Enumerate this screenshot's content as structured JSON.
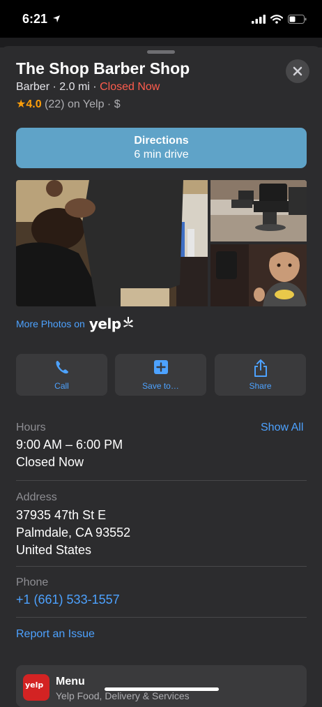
{
  "status_bar": {
    "time": "6:21"
  },
  "place": {
    "name": "The Shop Barber Shop",
    "category": "Barber",
    "separator": "·",
    "distance": "2.0 mi",
    "open_status": "Closed Now",
    "rating": "4.0",
    "review_count": "(22)",
    "rating_source": "on Yelp",
    "price": "$"
  },
  "directions": {
    "label": "Directions",
    "sublabel": "6 min drive"
  },
  "photos": {
    "more_label": "More Photos on",
    "provider": "yelp"
  },
  "actions": [
    {
      "label": "Call",
      "icon": "phone-icon"
    },
    {
      "label": "Save to…",
      "icon": "plus-square-icon"
    },
    {
      "label": "Share",
      "icon": "share-icon"
    }
  ],
  "hours": {
    "label": "Hours",
    "show_all": "Show All",
    "value": "9:00 AM – 6:00 PM",
    "status": "Closed Now"
  },
  "address": {
    "label": "Address",
    "line1": "37935 47th St E",
    "line2": "Palmdale, CA  93552",
    "line3": "United States"
  },
  "phone": {
    "label": "Phone",
    "value": "+1 (661) 533-1557"
  },
  "report_issue": "Report an Issue",
  "menu_card": {
    "title": "Menu",
    "subtitle": "Yelp Food, Delivery & Services",
    "logo_text": "yelp"
  },
  "colors": {
    "accent": "#4da2ff",
    "closed": "#ff5c4d",
    "star": "#ff9f0a",
    "directions_bg": "#5fa3c8",
    "sheet_bg": "#2c2c2e"
  }
}
